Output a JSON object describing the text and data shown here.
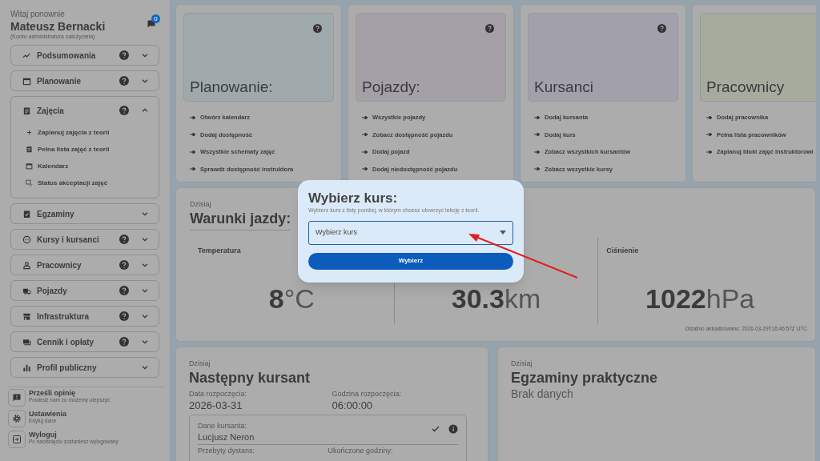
{
  "header": {
    "greeting": "Witaj ponownie",
    "name": "Mateusz Bernacki",
    "role": "(Konto administratora założyciela)",
    "notification_count": "0"
  },
  "nav": [
    {
      "label": "Podsumowania",
      "help": true,
      "expanded": false
    },
    {
      "label": "Planowanie",
      "help": true,
      "expanded": false
    },
    {
      "label": "Zajęcia",
      "help": true,
      "expanded": true,
      "children": [
        {
          "label": "Zaplanuj zajęcia z teorii"
        },
        {
          "label": "Pełna lista zajęć z teorii"
        },
        {
          "label": "Kalendarz"
        },
        {
          "label": "Status akceptacji zajęć"
        }
      ]
    },
    {
      "label": "Egzaminy",
      "help": false,
      "expanded": false
    },
    {
      "label": "Kursy i kursanci",
      "help": true,
      "expanded": false
    },
    {
      "label": "Pracownicy",
      "help": true,
      "expanded": false
    },
    {
      "label": "Pojazdy",
      "help": true,
      "expanded": false
    },
    {
      "label": "Infrastruktura",
      "help": true,
      "expanded": false
    },
    {
      "label": "Cennik i opłaty",
      "help": true,
      "expanded": false
    },
    {
      "label": "Profil publiczny",
      "help": false,
      "expanded": false
    }
  ],
  "footer_actions": [
    {
      "title": "Prześli opinię",
      "subtitle": "Powiedz nam co możemy ulepszyć"
    },
    {
      "title": "Ustawienia",
      "subtitle": "Edytuj dane"
    },
    {
      "title": "Wyloguj",
      "subtitle": "Po naciśnięciu zostaniesz wylogowany"
    }
  ],
  "tiles": [
    {
      "title": "Planowanie:",
      "help": true,
      "color": "#9fa9ab",
      "links": [
        "Otwórz kalendarz",
        "Dodaj dostępność",
        "Wszystkie schematy zajęć",
        "Sprawdź dostępność instruktora"
      ]
    },
    {
      "title": "Pojazdy:",
      "help": true,
      "color": "#a59fa8",
      "links": [
        "Wszystkie pojazdy",
        "Zobacz dostępność pojazdu",
        "Dodaj pojazd",
        "Dodaj niedostępność pojazdu"
      ]
    },
    {
      "title": "Kursanci",
      "help": true,
      "color": "#a2a1ab",
      "links": [
        "Dodaj kursanta",
        "Dodaj kurs",
        "Zobacz wszystkich kursantów",
        "Zobacz wszystkie kursy"
      ]
    },
    {
      "title": "Pracownicy",
      "help": false,
      "color": "#a7ab9e",
      "links": [
        "Dodaj pracownika",
        "Pełna lista pracowników",
        "Zaplanuj bloki zajęć instruktorowi"
      ]
    }
  ],
  "weather": {
    "overline": "Dzisiaj",
    "title": "Warunki jazdy:",
    "metrics": [
      {
        "label": "Temperatura",
        "value": "8",
        "unit": "°C"
      },
      {
        "value": "30.3",
        "unit": "km"
      },
      {
        "label": "Ciśnienie",
        "value": "1022",
        "unit": "hPa"
      }
    ],
    "updated": "Ostatnio aktualizowano: 2026-03-29T16:46:57Z UTC"
  },
  "next_student": {
    "overline": "Dzisiaj",
    "title": "Następny kursant",
    "fields": [
      {
        "label": "Data rozpoczęcia:",
        "value": "2026-03-31"
      },
      {
        "label": "Godzina rozpoczęcia:",
        "value": "06:00:00"
      }
    ],
    "student": {
      "label": "Dane kursanta:",
      "name": "Lucjusz Neron",
      "confirmed": true,
      "stats": [
        "Przebyty dystans:",
        "Ukończone godziny:"
      ]
    }
  },
  "exams": {
    "overline": "Dzisiaj",
    "title": "Egzaminy praktyczne",
    "empty": "Brak danych"
  },
  "modal": {
    "title": "Wybierz kurs:",
    "subtitle": "Wybierz kurs z listy poniżej, w którym chcesz utowrzyć lekcję z teorii.",
    "select": {
      "placeholder": "Wybierz kurs"
    },
    "button": "Wybierz"
  }
}
